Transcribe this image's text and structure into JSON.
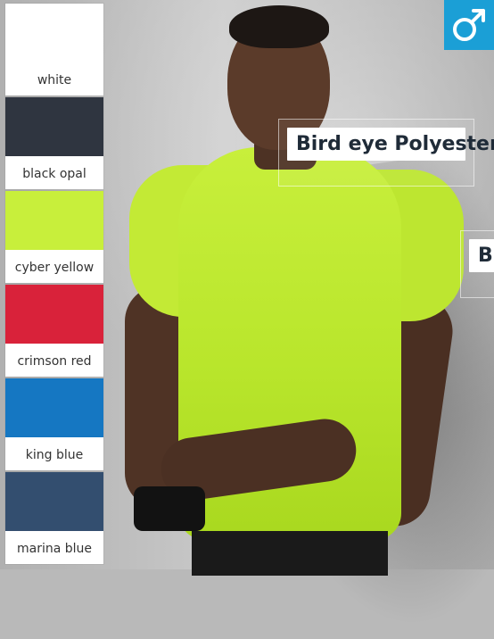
{
  "gender_icon": "male-symbol-icon",
  "colors": {
    "badge_blue": "#1b9fd6",
    "tshirt_lime": "#c3ea35"
  },
  "swatches": [
    {
      "label": "white",
      "color": "#ffffff"
    },
    {
      "label": "black opal",
      "color": "#2f3540"
    },
    {
      "label": "cyber yellow",
      "color": "#c8ef3b"
    },
    {
      "label": "crimson red",
      "color": "#d9223a"
    },
    {
      "label": "king blue",
      "color": "#1577c2"
    },
    {
      "label": "marina blue",
      "color": "#334e6f"
    }
  ],
  "callouts": [
    {
      "text": "Bird eye Polyester"
    },
    {
      "text": "Bi"
    }
  ]
}
